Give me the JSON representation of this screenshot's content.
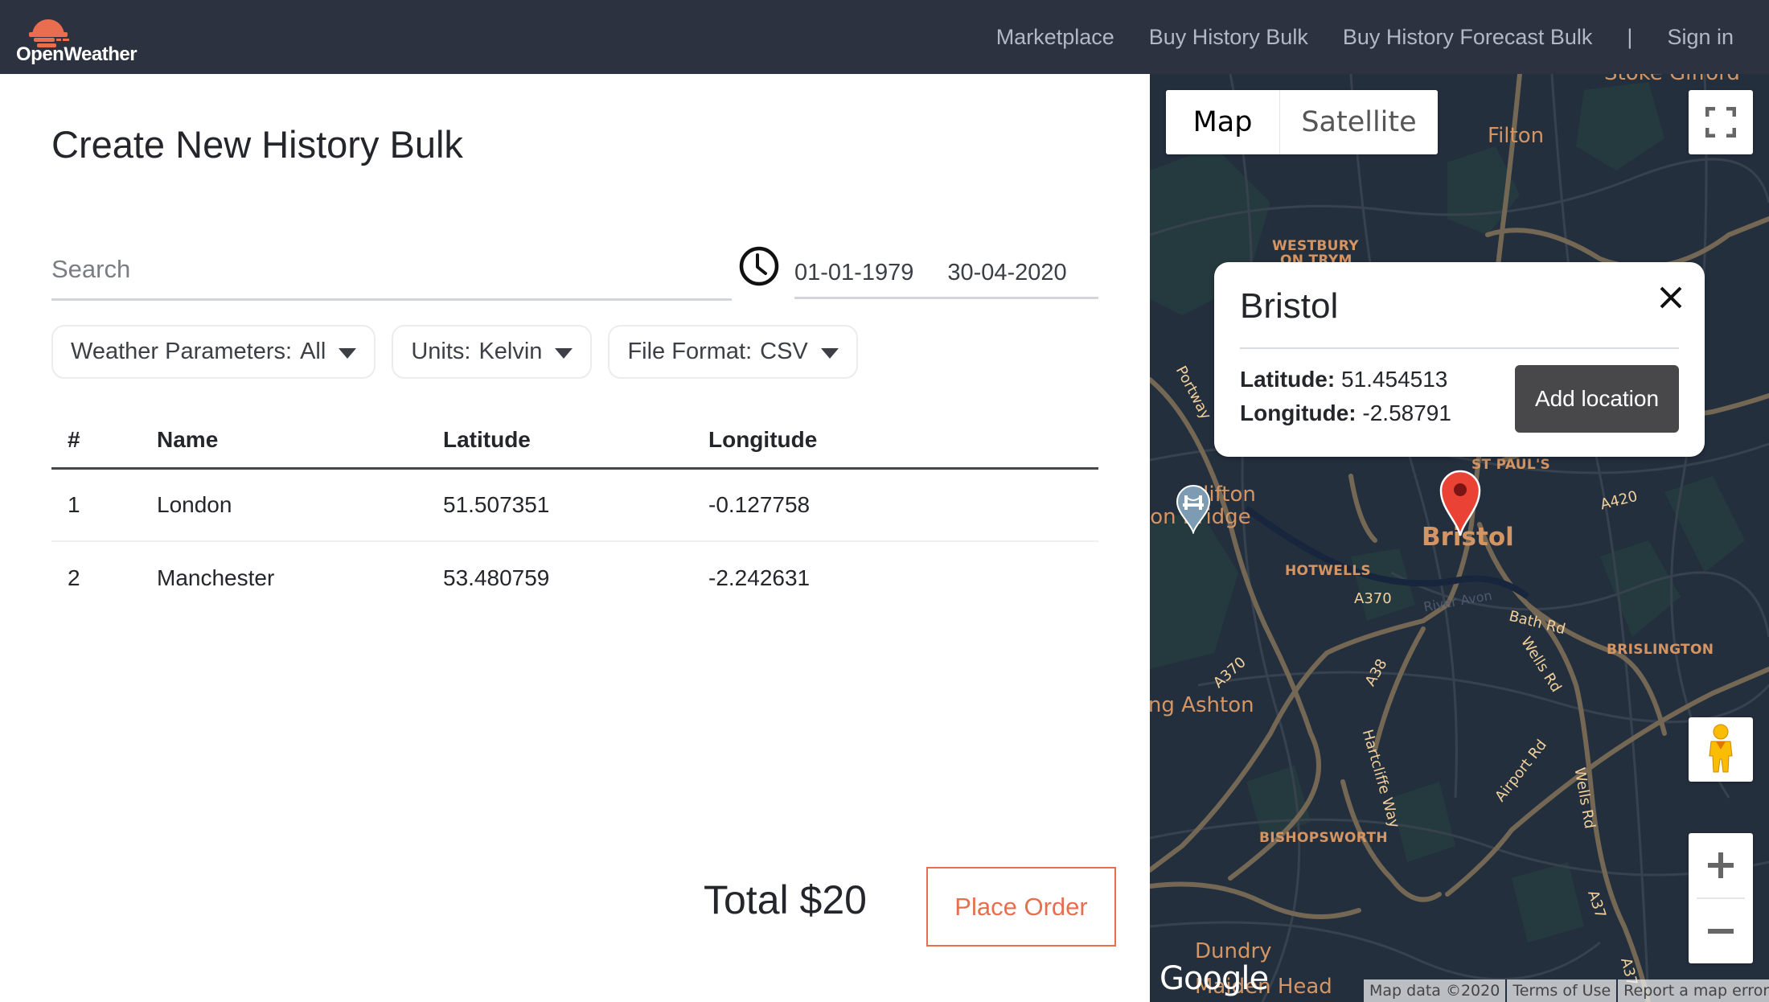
{
  "nav": {
    "logo_text": "OpenWeather",
    "links": [
      "Marketplace",
      "Buy History Bulk",
      "Buy History Forecast Bulk"
    ],
    "separator": "|",
    "sign_in": "Sign in"
  },
  "page": {
    "title": "Create New History Bulk"
  },
  "search": {
    "placeholder": "Search",
    "value": ""
  },
  "date_range": {
    "start": "01-01-1979",
    "end": "30-04-2020"
  },
  "dropdowns": [
    {
      "label": "Weather Parameters:",
      "value": "All"
    },
    {
      "label": "Units:",
      "value": "Kelvin"
    },
    {
      "label": "File Format:",
      "value": "CSV"
    }
  ],
  "table": {
    "headers": [
      "#",
      "Name",
      "Latitude",
      "Longitude"
    ],
    "rows": [
      {
        "num": "1",
        "name": "London",
        "lat": "51.507351",
        "lon": "-0.127758"
      },
      {
        "num": "2",
        "name": "Manchester",
        "lat": "53.480759",
        "lon": "-2.242631"
      }
    ]
  },
  "order": {
    "total": "Total $20",
    "button": "Place Order"
  },
  "map": {
    "type_controls": [
      "Map",
      "Satellite"
    ],
    "selected_type": "Map",
    "popup": {
      "title": "Bristol",
      "lat_label": "Latitude:",
      "lat_value": "51.454513",
      "lon_label": "Longitude:",
      "lon_value": "-2.58791",
      "button": "Add location"
    },
    "labels": {
      "stoke_gifford": "Stoke Gifford",
      "filton": "Filton",
      "westbury": "WESTBURY",
      "on_trym": "ON TRYM",
      "portway": "Portway",
      "st_pauls": "ST PAUL'S",
      "clifton": "Clifton",
      "suspension_bridge": "Suspension Bridge",
      "bristol": "Bristol",
      "a420": "A420",
      "hotwells": "HOTWELLS",
      "a370": "A370",
      "river": "River Avon",
      "bath_rd": "Bath Rd",
      "brislington": "BRISLINGTON",
      "wells_rd": "Wells Rd",
      "a38": "A38",
      "a370_b": "A370",
      "long_ashton": "Long Ashton",
      "hartcliffe": "Hartcliffe Way",
      "airport_rd": "Airport Rd",
      "wells_rd_b": "Wells Rd",
      "bishopsworth": "BISHOPSWORTH",
      "a37": "A37",
      "a37_b": "A37",
      "dundry": "Dundry",
      "maiden_head": "Maiden Head"
    },
    "google_logo": "Google",
    "attribution": [
      "Map data ©2020",
      "Terms of Use",
      "Report a map error"
    ],
    "colors": {
      "background": "#242f3e",
      "road": "#746855",
      "park": "#263c3f",
      "label": "#d59563",
      "marker": "#ea4335"
    }
  },
  "colors": {
    "nav_bg": "#2d3240",
    "brand_orange": "#e96e50",
    "button_dark": "#48484a"
  }
}
